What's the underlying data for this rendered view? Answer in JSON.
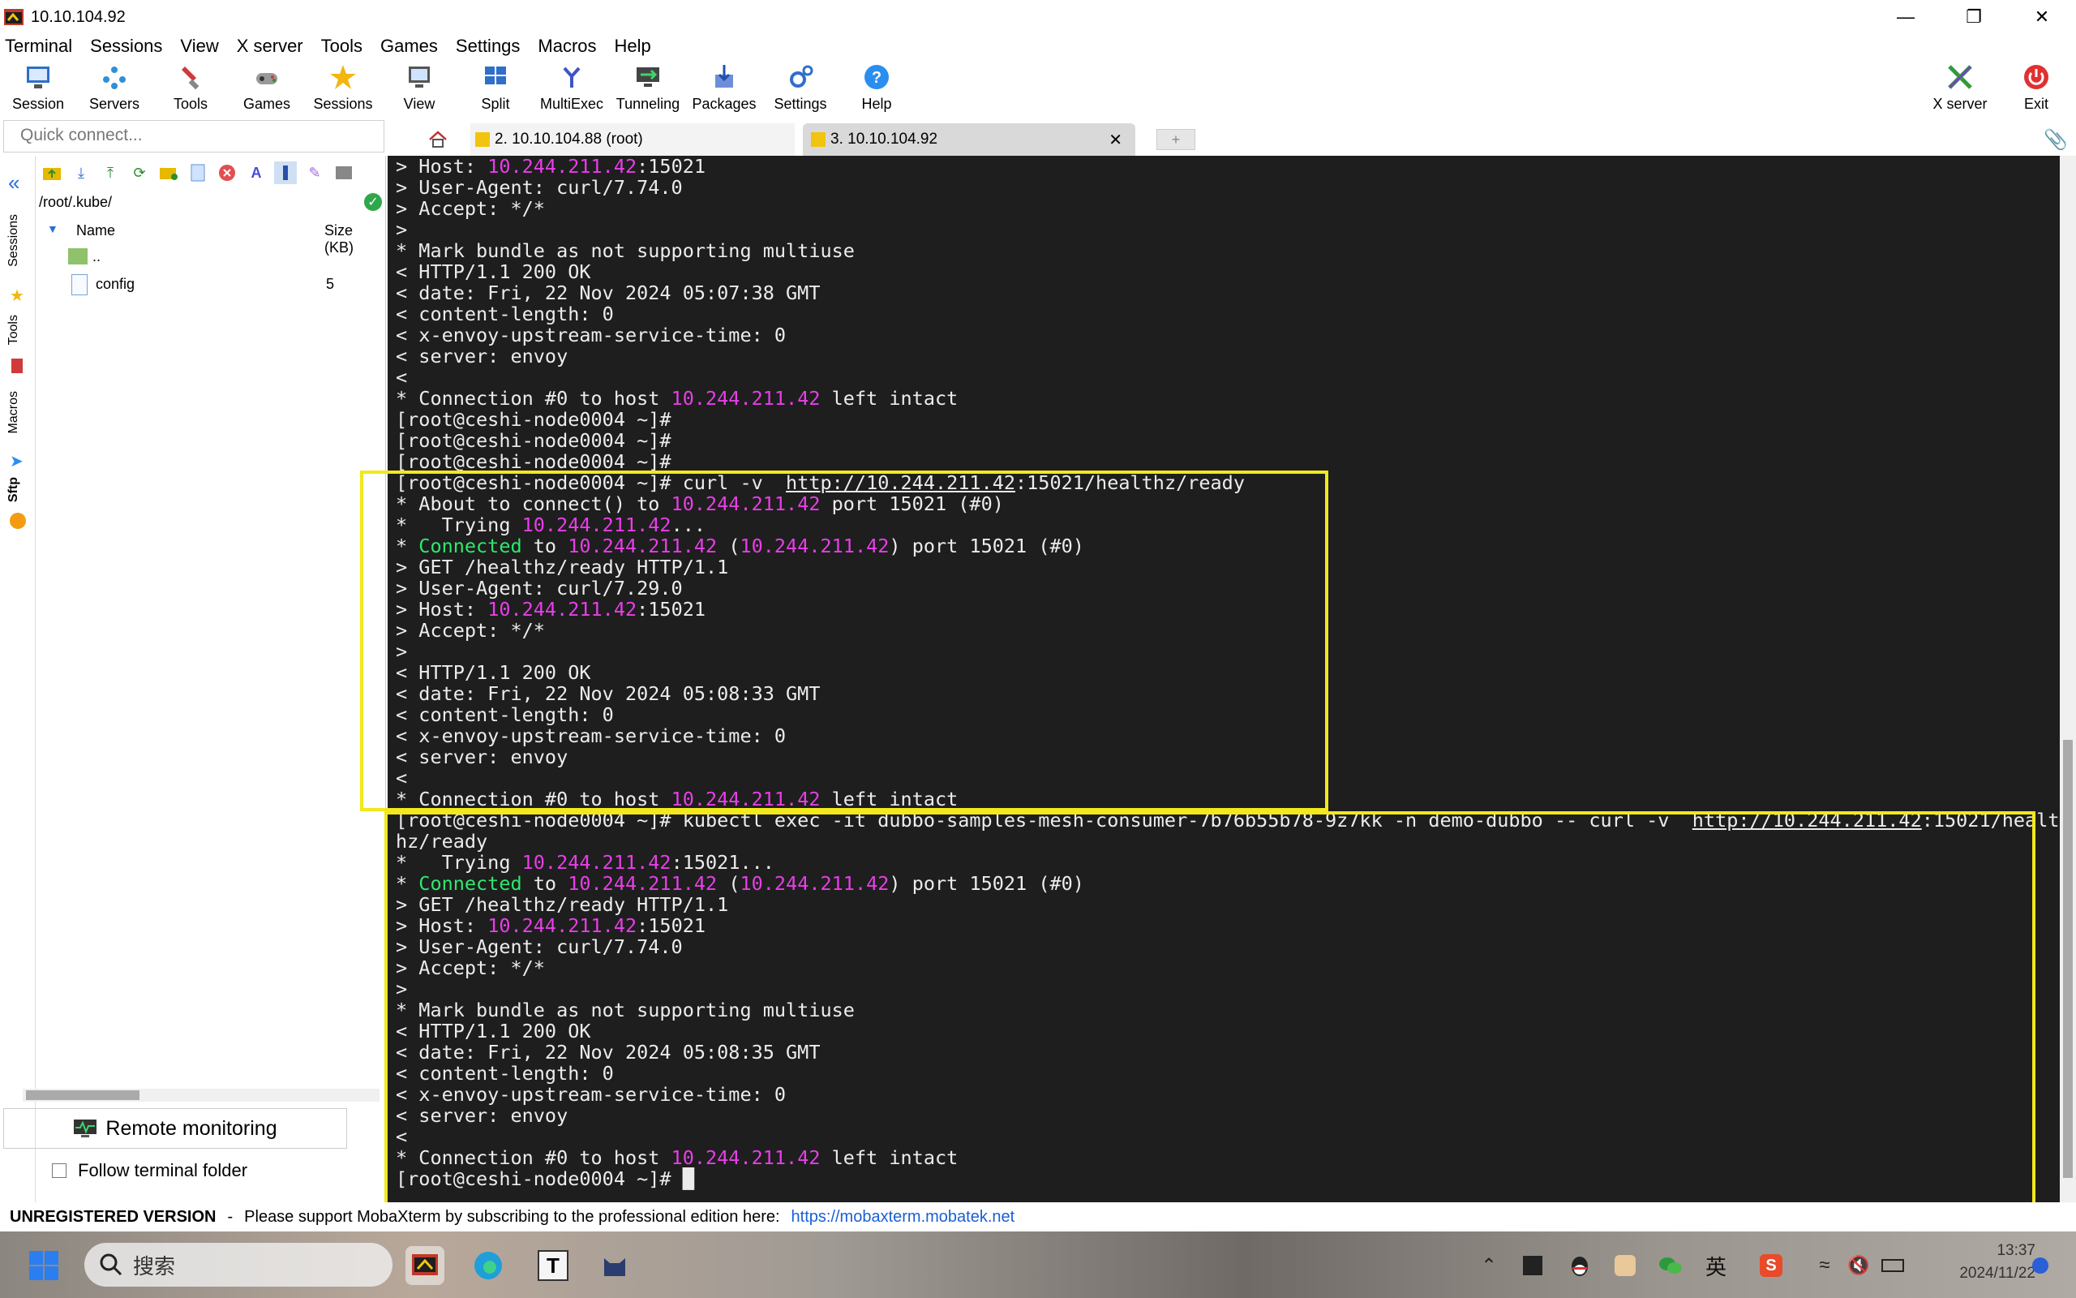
{
  "window": {
    "title": "10.10.104.92"
  },
  "menu": [
    "Terminal",
    "Sessions",
    "View",
    "X server",
    "Tools",
    "Games",
    "Settings",
    "Macros",
    "Help"
  ],
  "toolbar": {
    "session": "Session",
    "servers": "Servers",
    "tools": "Tools",
    "games": "Games",
    "sessions": "Sessions",
    "view": "View",
    "split": "Split",
    "multiexec": "MultiExec",
    "tunneling": "Tunneling",
    "packages": "Packages",
    "settings": "Settings",
    "help": "Help",
    "xserver": "X server",
    "exit": "Exit"
  },
  "quick_connect": {
    "placeholder": "Quick connect..."
  },
  "tabs": [
    "2. 10.10.104.88 (root)",
    "3. 10.10.104.92"
  ],
  "side_labels": [
    "Sessions",
    "Tools",
    "Macros",
    "Sftp"
  ],
  "sftp": {
    "path": "/root/.kube/",
    "columns": {
      "name": "Name",
      "size": "Size (KB)"
    },
    "files": [
      {
        "name": "..",
        "size": ""
      },
      {
        "name": "config",
        "size": "5"
      }
    ],
    "remote_monitoring": "Remote monitoring",
    "follow_folder": "Follow terminal folder"
  },
  "terminal_lines": [
    [
      {
        "t": "> Host: "
      },
      {
        "t": "10.244.211.42",
        "c": "p"
      },
      {
        "t": ":15021"
      }
    ],
    [
      {
        "t": "> User-Agent: curl/7.74.0"
      }
    ],
    [
      {
        "t": "> Accept: */*"
      }
    ],
    [
      {
        "t": ">"
      }
    ],
    [
      {
        "t": "* Mark bundle as not supporting multiuse"
      }
    ],
    [
      {
        "t": "< HTTP/1.1 200 OK"
      }
    ],
    [
      {
        "t": "< date: Fri, 22 Nov 2024 05:07:38 GMT"
      }
    ],
    [
      {
        "t": "< content-length: 0"
      }
    ],
    [
      {
        "t": "< x-envoy-upstream-service-time: 0"
      }
    ],
    [
      {
        "t": "< server: envoy"
      }
    ],
    [
      {
        "t": "<"
      }
    ],
    [
      {
        "t": "* Connection #0 to host "
      },
      {
        "t": "10.244.211.42",
        "c": "p"
      },
      {
        "t": " left intact"
      }
    ],
    [
      {
        "t": "[root@ceshi-node0004 ~]#"
      }
    ],
    [
      {
        "t": "[root@ceshi-node0004 ~]#"
      }
    ],
    [
      {
        "t": "[root@ceshi-node0004 ~]#"
      }
    ],
    [
      {
        "t": "[root@ceshi-node0004 ~]# curl -v  "
      },
      {
        "t": "http://10.244.211.42",
        "c": "u"
      },
      {
        "t": ":15021/healthz/ready"
      }
    ],
    [
      {
        "t": "* About to connect() to "
      },
      {
        "t": "10.244.211.42",
        "c": "p"
      },
      {
        "t": " port 15021 (#0)"
      }
    ],
    [
      {
        "t": "*   Trying "
      },
      {
        "t": "10.244.211.42",
        "c": "p"
      },
      {
        "t": "..."
      }
    ],
    [
      {
        "t": "* "
      },
      {
        "t": "Connected",
        "c": "g"
      },
      {
        "t": " to "
      },
      {
        "t": "10.244.211.42",
        "c": "p"
      },
      {
        "t": " ("
      },
      {
        "t": "10.244.211.42",
        "c": "p"
      },
      {
        "t": ") port 15021 (#0)"
      }
    ],
    [
      {
        "t": "> GET /healthz/ready HTTP/1.1"
      }
    ],
    [
      {
        "t": "> User-Agent: curl/7.29.0"
      }
    ],
    [
      {
        "t": "> Host: "
      },
      {
        "t": "10.244.211.42",
        "c": "p"
      },
      {
        "t": ":15021"
      }
    ],
    [
      {
        "t": "> Accept: */*"
      }
    ],
    [
      {
        "t": ">"
      }
    ],
    [
      {
        "t": "< HTTP/1.1 200 OK"
      }
    ],
    [
      {
        "t": "< date: Fri, 22 Nov 2024 05:08:33 GMT"
      }
    ],
    [
      {
        "t": "< content-length: 0"
      }
    ],
    [
      {
        "t": "< x-envoy-upstream-service-time: 0"
      }
    ],
    [
      {
        "t": "< server: envoy"
      }
    ],
    [
      {
        "t": "<"
      }
    ],
    [
      {
        "t": "* Connection #0 to host "
      },
      {
        "t": "10.244.211.42",
        "c": "p"
      },
      {
        "t": " left intact"
      }
    ],
    [
      {
        "t": "[root@ceshi-node0004 ~]# kubectl exec -it dubbo-samples-mesh-consumer-7b76b55b78-9z7kk -n demo-dubbo -- curl -v  "
      },
      {
        "t": "http://10.244.211.42",
        "c": "u"
      },
      {
        "t": ":15021/healt"
      }
    ],
    [
      {
        "t": "hz/ready"
      }
    ],
    [
      {
        "t": "*   Trying "
      },
      {
        "t": "10.244.211.42",
        "c": "p"
      },
      {
        "t": ":15021..."
      }
    ],
    [
      {
        "t": "* "
      },
      {
        "t": "Connected",
        "c": "g"
      },
      {
        "t": " to "
      },
      {
        "t": "10.244.211.42",
        "c": "p"
      },
      {
        "t": " ("
      },
      {
        "t": "10.244.211.42",
        "c": "p"
      },
      {
        "t": ") port 15021 (#0)"
      }
    ],
    [
      {
        "t": "> GET /healthz/ready HTTP/1.1"
      }
    ],
    [
      {
        "t": "> Host: "
      },
      {
        "t": "10.244.211.42",
        "c": "p"
      },
      {
        "t": ":15021"
      }
    ],
    [
      {
        "t": "> User-Agent: curl/7.74.0"
      }
    ],
    [
      {
        "t": "> Accept: */*"
      }
    ],
    [
      {
        "t": ">"
      }
    ],
    [
      {
        "t": "* Mark bundle as not supporting multiuse"
      }
    ],
    [
      {
        "t": "< HTTP/1.1 200 OK"
      }
    ],
    [
      {
        "t": "< date: Fri, 22 Nov 2024 05:08:35 GMT"
      }
    ],
    [
      {
        "t": "< content-length: 0"
      }
    ],
    [
      {
        "t": "< x-envoy-upstream-service-time: 0"
      }
    ],
    [
      {
        "t": "< server: envoy"
      }
    ],
    [
      {
        "t": "<"
      }
    ],
    [
      {
        "t": "* Connection #0 to host "
      },
      {
        "t": "10.244.211.42",
        "c": "p"
      },
      {
        "t": " left intact"
      }
    ],
    [
      {
        "t": "[root@ceshi-node0004 ~]# "
      },
      {
        "t": "█",
        "c": "cursor"
      }
    ]
  ],
  "status": {
    "unregistered": "UNREGISTERED VERSION",
    "dash": "-",
    "message": "Please support MobaXterm by subscribing to the professional edition here:",
    "link": "https://mobaxterm.mobatek.net"
  },
  "taskbar": {
    "search": "搜索",
    "ime": "英",
    "time": "13:37",
    "date": "2024/11/22"
  },
  "colors": {
    "highlight": "#f2e81c",
    "ip": "#e83ee8",
    "connected": "#2ee86e",
    "terminal_bg": "#1e1e1e"
  }
}
